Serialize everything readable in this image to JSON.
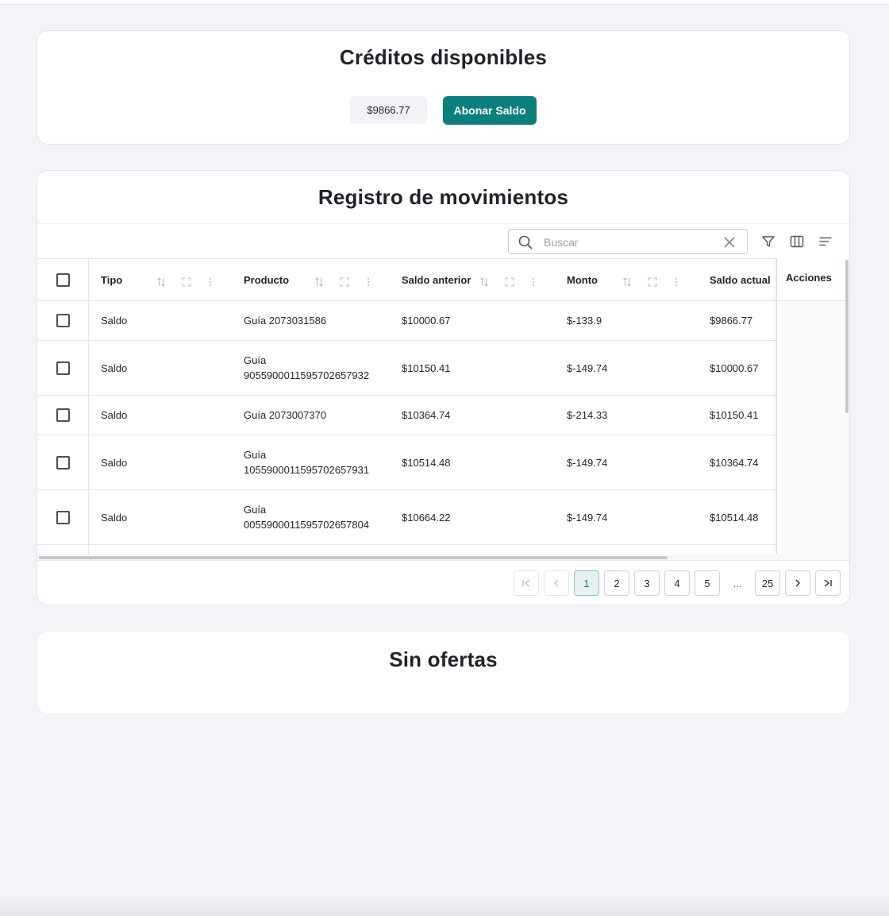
{
  "credits": {
    "title": "Créditos disponibles",
    "balance": "$9866.77",
    "topup_label": "Abonar Saldo"
  },
  "movements": {
    "title": "Registro de movimientos",
    "search": {
      "placeholder": "Buscar",
      "value": ""
    },
    "toolbar_icons": [
      "filter-icon",
      "columns-icon",
      "density-icon"
    ],
    "columns": [
      "Tipo",
      "Producto",
      "Saldo anterior",
      "Monto",
      "Saldo actual",
      "Acciones"
    ],
    "rows": [
      {
        "tipo": "Saldo",
        "producto": "Guía 2073031586",
        "anterior": "$10000.67",
        "monto": "$-133.9",
        "actual": "$9866.77"
      },
      {
        "tipo": "Saldo",
        "producto": "Guía 9055900011595702657932",
        "producto_l1": "Guía",
        "producto_l2": "9055900011595702657932",
        "anterior": "$10150.41",
        "monto": "$-149.74",
        "actual": "$10000.67"
      },
      {
        "tipo": "Saldo",
        "producto": "Guía 2073007370",
        "anterior": "$10364.74",
        "monto": "$-214.33",
        "actual": "$10150.41"
      },
      {
        "tipo": "Saldo",
        "producto": "Guía 1055900011595702657931",
        "producto_l1": "Guía",
        "producto_l2": "1055900011595702657931",
        "anterior": "$10514.48",
        "monto": "$-149.74",
        "actual": "$10364.74"
      },
      {
        "tipo": "Saldo",
        "producto": "Guía 0055900011595702657804",
        "producto_l1": "Guía",
        "producto_l2": "0055900011595702657804",
        "anterior": "$10664.22",
        "monto": "$-149.74",
        "actual": "$10514.48"
      }
    ],
    "pagination": {
      "current": 1,
      "pages": [
        "1",
        "2",
        "3",
        "4",
        "5"
      ],
      "ellipsis": "...",
      "last": "25"
    }
  },
  "offers": {
    "title": "Sin ofertas"
  },
  "colors": {
    "accent": "#0b7f7c",
    "background": "#f3f4f7",
    "card": "#ffffff"
  }
}
